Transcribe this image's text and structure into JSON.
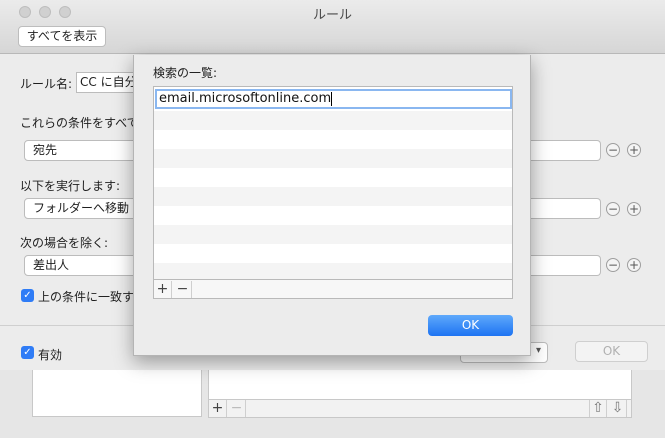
{
  "window": {
    "title": "ルール",
    "show_all": "すべてを表示"
  },
  "rule": {
    "name_label": "ルール名:",
    "name_value": "CC に自分",
    "conditions_label": "これらの条件をすべて",
    "condition_popup": "宛先",
    "actions_label": "以下を実行します:",
    "action_popup": "フォルダーへ移動",
    "exceptions_label": "次の場合を除く:",
    "exception_popup": "差出人",
    "stop_label": "上の条件に一致す",
    "enabled_label": "有効",
    "ok_label": "OK"
  },
  "sheet": {
    "title": "検索の一覧:",
    "entries": [
      "email.microsoftonline.com"
    ],
    "add_label": "+",
    "remove_label": "−",
    "ok_label": "OK"
  },
  "icons": {
    "minus": "−",
    "plus": "+",
    "check": "✓",
    "up": "⇧",
    "down": "⇩"
  }
}
